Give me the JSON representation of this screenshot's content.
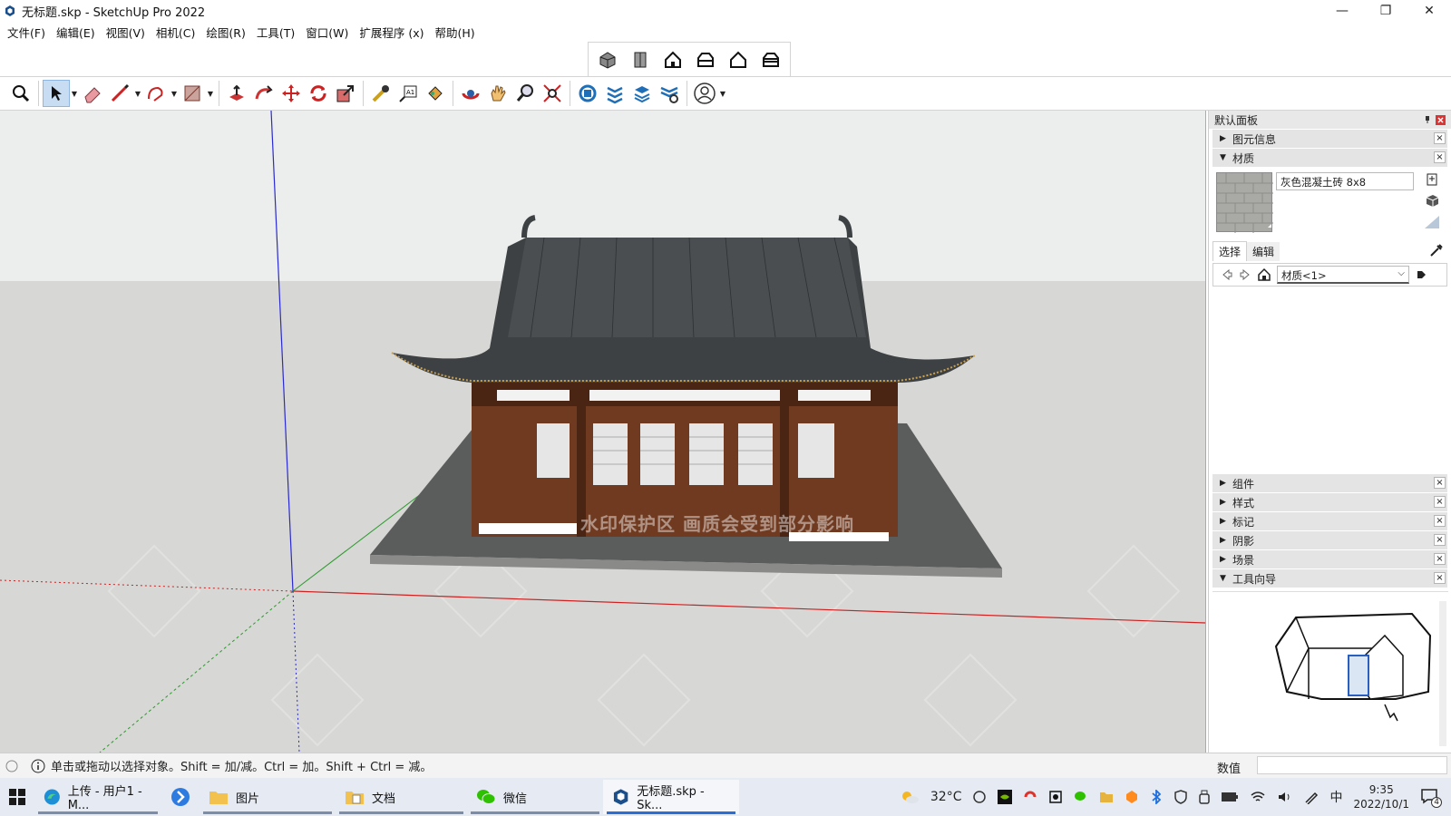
{
  "window": {
    "title": "无标题.skp - SketchUp Pro 2022",
    "min": "—",
    "restore": "❐",
    "close": "✕"
  },
  "menu": [
    "文件(F)",
    "编辑(E)",
    "视图(V)",
    "相机(C)",
    "绘图(R)",
    "工具(T)",
    "窗口(W)",
    "扩展程序 (x)",
    "帮助(H)"
  ],
  "toolbar_top_icons": [
    "iso-view-icon",
    "top-view-icon",
    "front-view-icon",
    "right-view-icon",
    "back-view-icon",
    "left-view-icon"
  ],
  "viewport": {
    "watermark": "水印保护区 画质会受到部分影响",
    "bg_color": "#d6d6d4",
    "sky_color": "#eceeed"
  },
  "panel": {
    "title": "默认面板",
    "sections_top": [
      {
        "label": "图元信息",
        "expanded": false
      },
      {
        "label": "材质",
        "expanded": true
      }
    ],
    "material_name": "灰色混凝土砖 8x8",
    "tabs": [
      "选择",
      "编辑"
    ],
    "library": "材质<1>",
    "sections_bottom": [
      {
        "label": "组件",
        "expanded": false
      },
      {
        "label": "样式",
        "expanded": false
      },
      {
        "label": "标记",
        "expanded": false
      },
      {
        "label": "阴影",
        "expanded": false
      },
      {
        "label": "场景",
        "expanded": false
      },
      {
        "label": "工具向导",
        "expanded": true
      }
    ],
    "close": "×"
  },
  "status": {
    "text": "单击或拖动以选择对象。Shift = 加/减。Ctrl = 加。Shift + Ctrl = 减。",
    "measure_label": "数值"
  },
  "taskbar": {
    "items": [
      {
        "label": "上传 - 用户1 - M...",
        "icon": "edge-icon"
      },
      {
        "label": "图片",
        "icon": "folder-icon"
      },
      {
        "label": "文档",
        "icon": "folder-icon"
      },
      {
        "label": "微信",
        "icon": "wechat-icon"
      },
      {
        "label": "无标题.skp - Sk...",
        "icon": "sketchup-icon"
      }
    ],
    "temperature": "32°C",
    "ime": "中",
    "time": "9:35",
    "date": "2022/10/1",
    "notifications": "4"
  }
}
